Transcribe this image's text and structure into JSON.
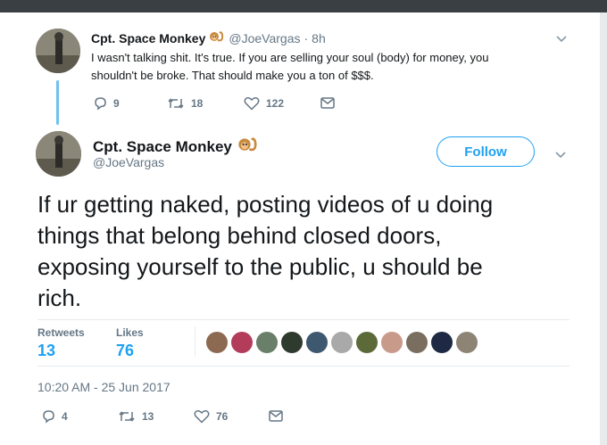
{
  "reply_tweet": {
    "display_name": "Cpt. Space Monkey",
    "handle": "@JoeVargas",
    "separator": "·",
    "time": "8h",
    "text_line1": "I wasn't talking shit. It's true. If you are selling your soul (body) for money, you",
    "text_line2": "shouldn't be broke. That should make you a ton of $$$.",
    "replies": "9",
    "retweets": "18",
    "likes": "122"
  },
  "main_tweet": {
    "display_name": "Cpt. Space Monkey",
    "handle": "@JoeVargas",
    "follow_label": "Follow",
    "text_lines": [
      "If ur getting naked, posting videos of u doing",
      "things that belong behind closed doors,",
      "exposing yourself to the public, u should be",
      "rich."
    ],
    "stats": {
      "retweets_label": "Retweets",
      "retweets_count": "13",
      "likes_label": "Likes",
      "likes_count": "76"
    },
    "timestamp": "10:20 AM - 25 Jun 2017",
    "actions": {
      "replies": "4",
      "retweets": "13",
      "likes": "76"
    }
  },
  "colors": {
    "accent": "#1da1f2",
    "thread_line": "#6fc2ee",
    "muted": "#657786",
    "text": "#14171a",
    "monkey": "#c98a3e"
  },
  "icons": {
    "reply": "reply-icon",
    "retweet": "retweet-icon",
    "like": "heart-icon",
    "message": "envelope-icon",
    "menu": "chevron-down-icon",
    "emoji": "monkey-emoji-icon"
  }
}
